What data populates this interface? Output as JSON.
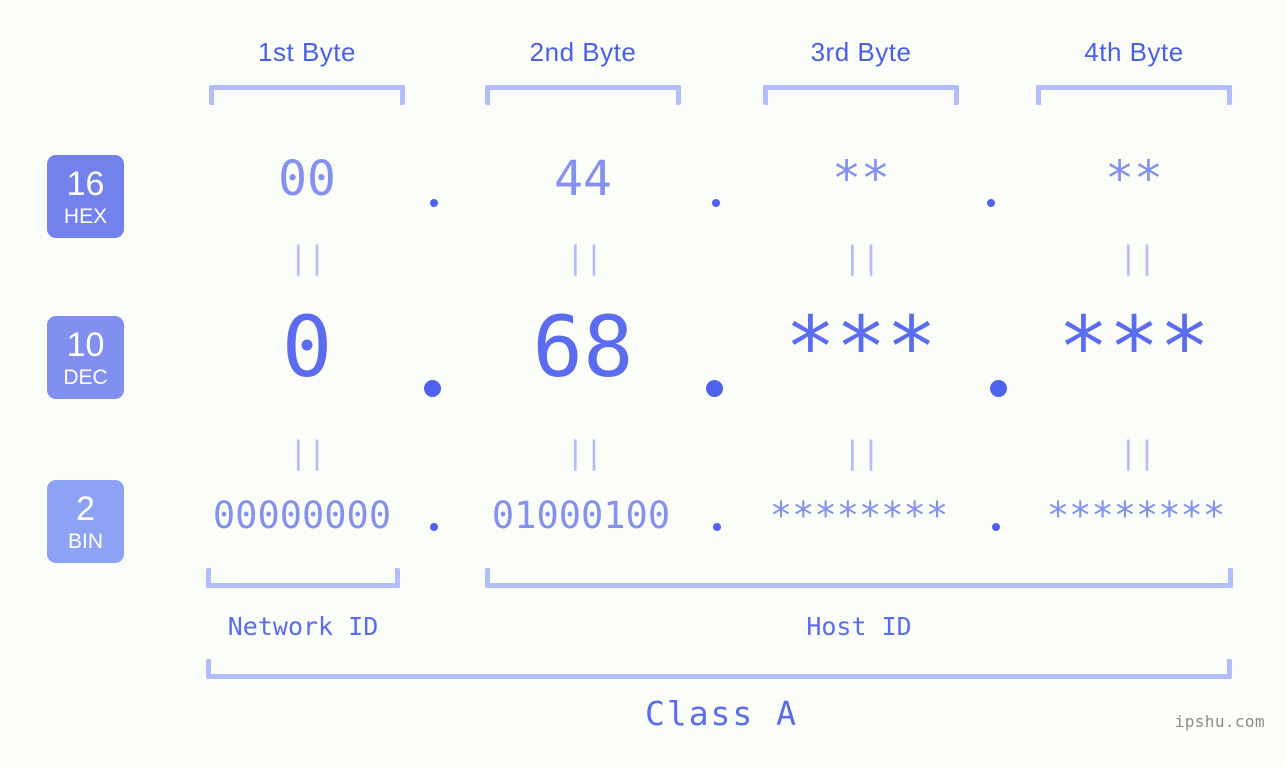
{
  "headers": [
    {
      "label": "1st Byte"
    },
    {
      "label": "2nd Byte"
    },
    {
      "label": "3rd Byte"
    },
    {
      "label": "4th Byte"
    }
  ],
  "bases": [
    {
      "num": "16",
      "name": "HEX",
      "color": "#7381ed"
    },
    {
      "num": "10",
      "name": "DEC",
      "color": "#8190f0"
    },
    {
      "num": "2",
      "name": "BIN",
      "color": "#8ca2f5"
    }
  ],
  "rows": {
    "hex": {
      "values": [
        "00",
        "44",
        "**",
        "**"
      ]
    },
    "dec": {
      "values": [
        "0",
        "68",
        "***",
        "***"
      ]
    },
    "bin": {
      "values": [
        "00000000",
        "01000100",
        "********",
        "********"
      ]
    }
  },
  "separator": ".",
  "equals_glyph": "||",
  "segments": [
    {
      "label": "Network ID"
    },
    {
      "label": "Host ID"
    }
  ],
  "class_label": "Class A",
  "watermark": "ipshu.com",
  "colors": {
    "background": "#fbfdf8",
    "header_text": "#4a5fe8",
    "bracket": "#b3bdfb",
    "hex_text": "#8591ee",
    "dec_text": "#5b6cf0",
    "bin_text": "#8591ee",
    "dot": "#4f62ef",
    "equals": "#b3bdfb",
    "caption_text": "#5b6cf0",
    "watermark_text": "#8c8c8c"
  }
}
